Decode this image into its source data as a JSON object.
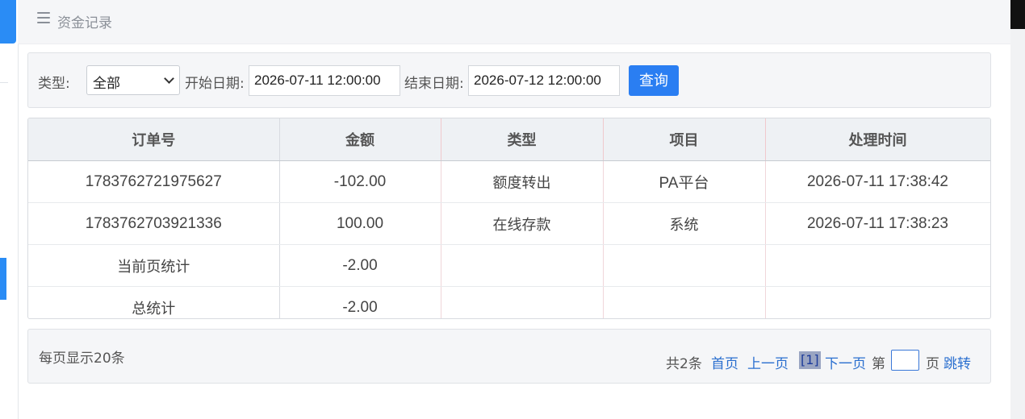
{
  "header": {
    "title": "资金记录"
  },
  "filter": {
    "type_label": "类型:",
    "type_value": "全部",
    "start_label": "开始日期:",
    "start_value": "2026-07-11 12:00:00",
    "end_label": "结束日期:",
    "end_value": "2026-07-12 12:00:00",
    "query_button": "查询"
  },
  "table": {
    "headers": [
      "订单号",
      "金额",
      "类型",
      "项目",
      "处理时间"
    ],
    "rows": [
      [
        "1783762721975627",
        "-102.00",
        "额度转出",
        "PA平台",
        "2026-07-11 17:38:42"
      ],
      [
        "1783762703921336",
        "100.00",
        "在线存款",
        "系统",
        "2026-07-11 17:38:23"
      ]
    ],
    "page_total_label": "当前页统计",
    "page_total_value": "-2.00",
    "grand_total_label": "总统计",
    "grand_total_value": "-2.00"
  },
  "pager": {
    "per_page": "每页显示20条",
    "total": "共2条",
    "first": "首页",
    "prev": "上一页",
    "current": "[1]",
    "next": "下一页",
    "page_prefix": "第",
    "page_suffix": "页",
    "jump": "跳转"
  },
  "colors": {
    "accent": "#2a7ef2",
    "link": "#2a6fcf"
  },
  "icons": {
    "menu": "menu-icon",
    "select_chevron": "chevron-down-icon"
  }
}
